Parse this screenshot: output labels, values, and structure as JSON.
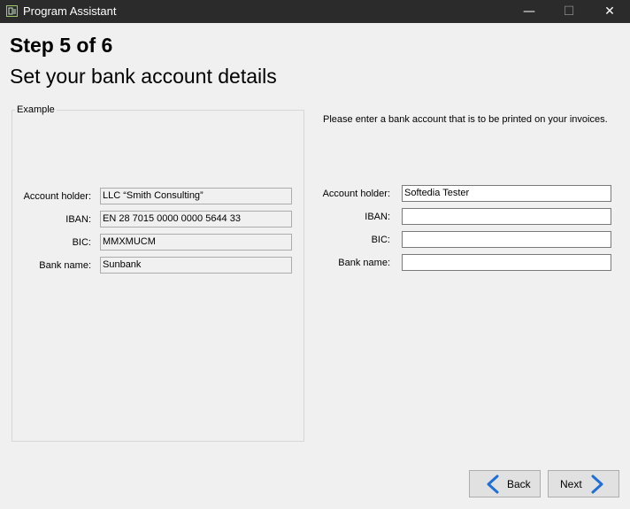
{
  "window": {
    "title": "Program Assistant",
    "controls": {
      "minimize": "—",
      "maximize": "☐",
      "close": "✕"
    }
  },
  "header": {
    "step": "Step 5 of 6",
    "subtitle": "Set your bank account details"
  },
  "example": {
    "legend": "Example",
    "fields": [
      {
        "label": "Account holder:",
        "value": "LLC “Smith Consulting”"
      },
      {
        "label": "IBAN:",
        "value": "EN 28 7015 0000 0000 5644 33"
      },
      {
        "label": "BIC:",
        "value": "MMXMUCM"
      },
      {
        "label": "Bank name:",
        "value": "Sunbank"
      }
    ]
  },
  "form": {
    "instruction": "Please enter a bank account that is to be printed on your invoices.",
    "fields": [
      {
        "label": "Account holder:",
        "value": "Softedia Tester"
      },
      {
        "label": "IBAN:",
        "value": ""
      },
      {
        "label": "BIC:",
        "value": ""
      },
      {
        "label": "Bank name:",
        "value": ""
      }
    ]
  },
  "footer": {
    "back_label": "Back",
    "next_label": "Next"
  },
  "colors": {
    "titlebar": "#2b2b2b",
    "arrow_blue": "#1f6fd6",
    "window_bg": "#f0f0f0"
  },
  "icons": {
    "app": "program-assistant-icon",
    "back": "arrow-left-icon",
    "next": "arrow-right-icon"
  }
}
